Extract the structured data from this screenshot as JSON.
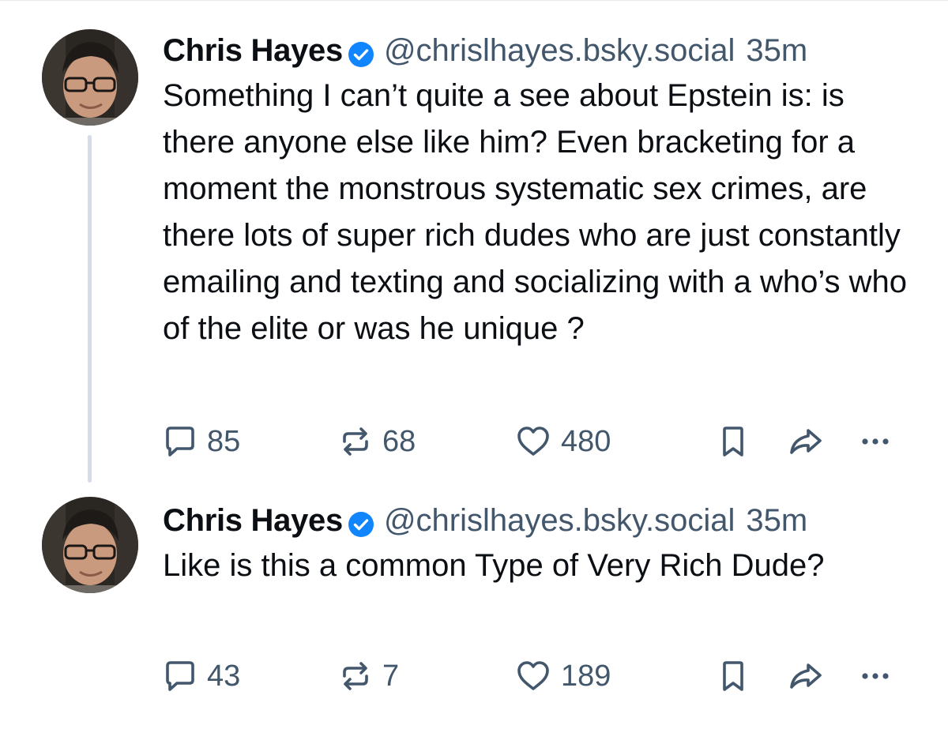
{
  "posts": [
    {
      "author": {
        "name": "Chris Hayes",
        "handle": "@chrislhayes.bsky.social",
        "verified": true
      },
      "time": "35m",
      "text": "Something I can’t quite a see about Epstein is: is there anyone else like him? Even bracketing for a moment the monstrous systematic sex crimes, are there lots of super rich dudes who are just constantly emailing and texting and socializing with a who’s who of the elite or was he unique ?",
      "stats": {
        "replies": "85",
        "reposts": "68",
        "likes": "480"
      }
    },
    {
      "author": {
        "name": "Chris Hayes",
        "handle": "@chrislhayes.bsky.social",
        "verified": true
      },
      "time": "35m",
      "text": "Like is this a common Type of Very Rich Dude?",
      "stats": {
        "replies": "43",
        "reposts": "7",
        "likes": "189"
      }
    }
  ],
  "icons": {
    "reply": "speech-bubble-icon",
    "repost": "repost-arrows-icon",
    "like": "heart-icon",
    "bookmark": "bookmark-icon",
    "share": "share-arrow-icon",
    "more": "ellipsis-icon",
    "verified": "verified-check-icon"
  },
  "colors": {
    "text": "#0b0f14",
    "muted": "#42576c",
    "verified": "#1185fe",
    "thread_line": "#d5dce5"
  }
}
